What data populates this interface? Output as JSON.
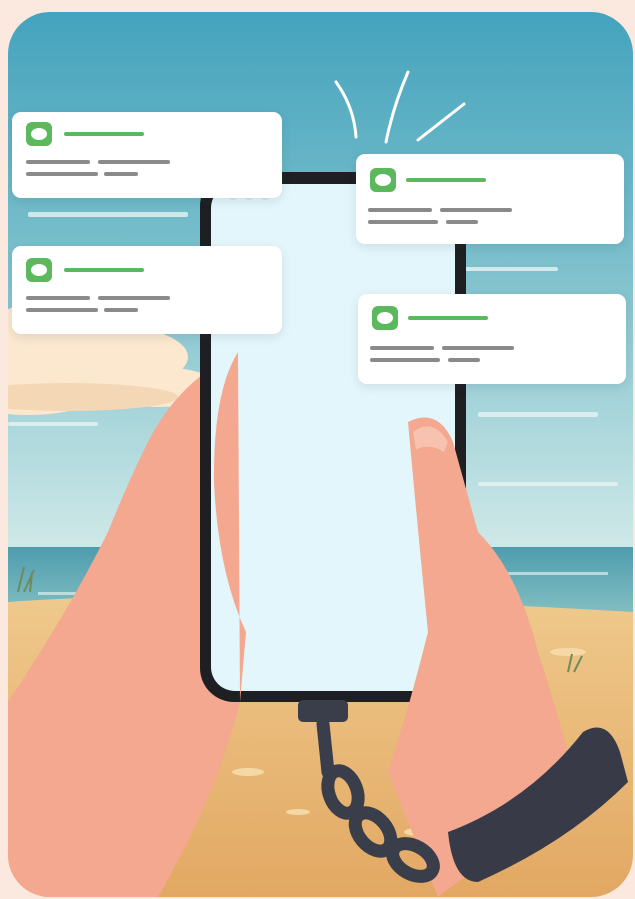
{
  "illustration": {
    "subject": "hand-holding-smartphone-chained-to-wrist-on-beach",
    "palette": {
      "sky_top": "#4ea8bf",
      "sky_bottom": "#bfe0de",
      "sea": "#5fa6b2",
      "sand": "#e9b978",
      "skin": "#f3a88f",
      "phone_frame": "#1d1f22",
      "phone_screen": "#e3f6fb",
      "chain": "#3a3d4a",
      "accent_green": "#5cb85c",
      "text_bar_grey": "#8a8a8a",
      "background": "#fbe9e0"
    }
  },
  "notifications": [
    {
      "icon": "message-bubble-icon"
    },
    {
      "icon": "message-bubble-icon"
    },
    {
      "icon": "message-bubble-icon"
    },
    {
      "icon": "message-bubble-icon"
    }
  ]
}
